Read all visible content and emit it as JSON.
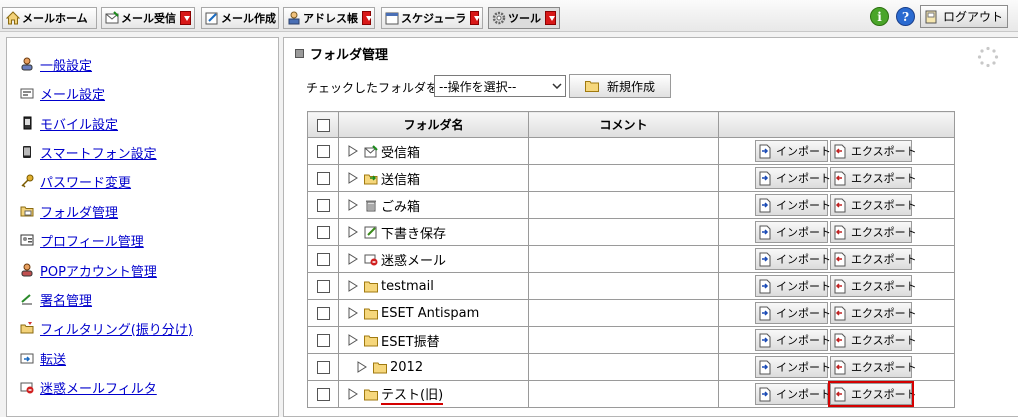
{
  "toolbar": {
    "items": [
      {
        "label": "メールホーム",
        "icon": "home-icon"
      },
      {
        "label": "メール受信",
        "icon": "mail-receive-icon"
      },
      {
        "label": "メール作成",
        "icon": "mail-compose-icon"
      },
      {
        "label": "アドレス帳",
        "icon": "address-book-icon"
      },
      {
        "label": "スケジューラ",
        "icon": "scheduler-icon"
      },
      {
        "label": "ツール",
        "icon": "gear-icon"
      }
    ],
    "logout_label": "ログアウト",
    "info_icon": "i",
    "help_icon": "?"
  },
  "sidebar": {
    "items": [
      {
        "label": "一般設定",
        "icon": "user-icon"
      },
      {
        "label": "メール設定",
        "icon": "mail-settings-icon"
      },
      {
        "label": "モバイル設定",
        "icon": "mobile-icon"
      },
      {
        "label": "スマートフォン設定",
        "icon": "smartphone-icon"
      },
      {
        "label": "パスワード変更",
        "icon": "key-icon"
      },
      {
        "label": "フォルダ管理",
        "icon": "folder-manage-icon"
      },
      {
        "label": "プロフィール管理",
        "icon": "profile-icon"
      },
      {
        "label": "POPアカウント管理",
        "icon": "pop-account-icon"
      },
      {
        "label": "署名管理",
        "icon": "signature-icon"
      },
      {
        "label": "フィルタリング(振り分け)",
        "icon": "filter-icon"
      },
      {
        "label": "転送",
        "icon": "forward-icon"
      },
      {
        "label": "迷惑メールフィルタ",
        "icon": "spam-filter-icon"
      }
    ]
  },
  "main": {
    "title": "フォルダ管理",
    "action_label": "チェックしたフォルダを",
    "action_select_value": "--操作を選択--",
    "new_folder_label": "新規作成",
    "table": {
      "headers": {
        "name": "フォルダ名",
        "comment": "コメント"
      },
      "import_label": "インポート",
      "export_label": "エクスポート",
      "rows": [
        {
          "name": "受信箱",
          "icon": "inbox-icon",
          "indent": false
        },
        {
          "name": "送信箱",
          "icon": "outbox-icon",
          "indent": false
        },
        {
          "name": "ごみ箱",
          "icon": "trash-icon",
          "indent": false
        },
        {
          "name": "下書き保存",
          "icon": "draft-icon",
          "indent": false
        },
        {
          "name": "迷惑メール",
          "icon": "spam-icon",
          "indent": false
        },
        {
          "name": "testmail",
          "icon": "folder-icon",
          "indent": false
        },
        {
          "name": "ESET Antispam",
          "icon": "folder-icon",
          "indent": false
        },
        {
          "name": "ESET振替",
          "icon": "folder-icon",
          "indent": false
        },
        {
          "name": "2012",
          "icon": "folder-icon",
          "indent": true
        },
        {
          "name": "テスト(旧)",
          "icon": "folder-icon",
          "indent": false,
          "highlight": true
        }
      ]
    }
  },
  "colors": {
    "link": "#0000cc",
    "highlight": "#d40000",
    "dropdown": "#d81818"
  }
}
